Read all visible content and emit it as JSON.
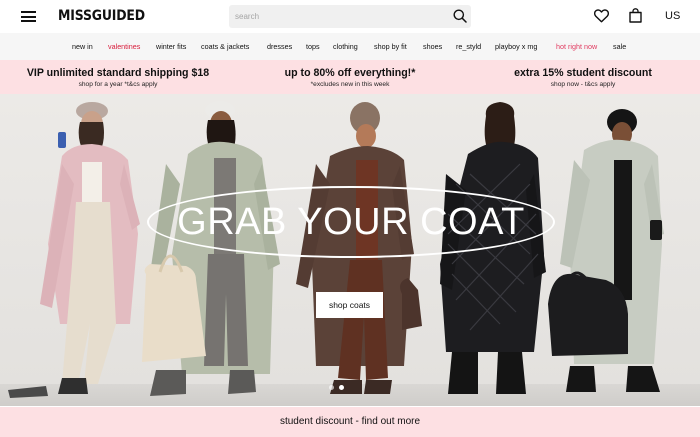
{
  "header": {
    "logo": "MISSGUIDED",
    "search_placeholder": "search",
    "region": "US",
    "icons": [
      "hamburger-menu-icon",
      "search-icon",
      "heart-icon",
      "bag-icon"
    ]
  },
  "nav": {
    "items": [
      {
        "label": "new in",
        "color": "#111111"
      },
      {
        "label": "valentines",
        "color": "#d81d3c"
      },
      {
        "label": "winter fits",
        "color": "#111111"
      },
      {
        "label": "coats & jackets",
        "color": "#111111"
      },
      {
        "label": "dresses",
        "color": "#111111"
      },
      {
        "label": "tops",
        "color": "#111111"
      },
      {
        "label": "clothing",
        "color": "#111111"
      },
      {
        "label": "shop by fit",
        "color": "#111111"
      },
      {
        "label": "shoes",
        "color": "#111111"
      },
      {
        "label": "re_styld",
        "color": "#111111"
      },
      {
        "label": "playboy x mg",
        "color": "#111111"
      },
      {
        "label": "hot right now",
        "color": "#e13a60"
      },
      {
        "label": "sale",
        "color": "#111111"
      }
    ]
  },
  "promo": [
    {
      "title": "VIP unlimited standard shipping $18",
      "subtitle": "shop for a year *t&cs apply"
    },
    {
      "title": "up to 80% off everything!*",
      "subtitle": "*excludes new in this week"
    },
    {
      "title": "extra 15% student discount",
      "subtitle": "shop now - t&cs apply"
    }
  ],
  "hero": {
    "heading": "GRAB YOUR COAT",
    "button_label": "shop coats",
    "carousel_active_index": 1,
    "carousel_count": 2
  },
  "footer_banner": {
    "label": "student discount - find out more"
  },
  "colors": {
    "accent_red": "#d81d3c",
    "accent_pink": "#e13a60",
    "promo_bg": "#fde0e3",
    "nav_bg": "#f6f6f6"
  }
}
